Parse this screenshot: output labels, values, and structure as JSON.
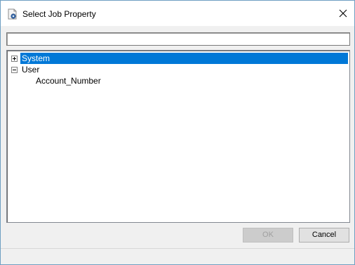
{
  "window": {
    "title": "Select Job Property",
    "icon": "document-gear-icon",
    "close_icon": "close-icon"
  },
  "filter": {
    "value": "",
    "placeholder": ""
  },
  "tree": {
    "nodes": [
      {
        "label": "System",
        "expander": "+",
        "selected": true
      },
      {
        "label": "User",
        "expander": "-",
        "selected": false,
        "children": [
          {
            "label": "Account_Number"
          }
        ]
      }
    ]
  },
  "buttons": {
    "ok_label": "OK",
    "ok_enabled": false,
    "cancel_label": "Cancel"
  },
  "colors": {
    "selection": "#0078d7",
    "window_border": "#6f9fc2",
    "dialog_bg": "#f0f0f0"
  }
}
